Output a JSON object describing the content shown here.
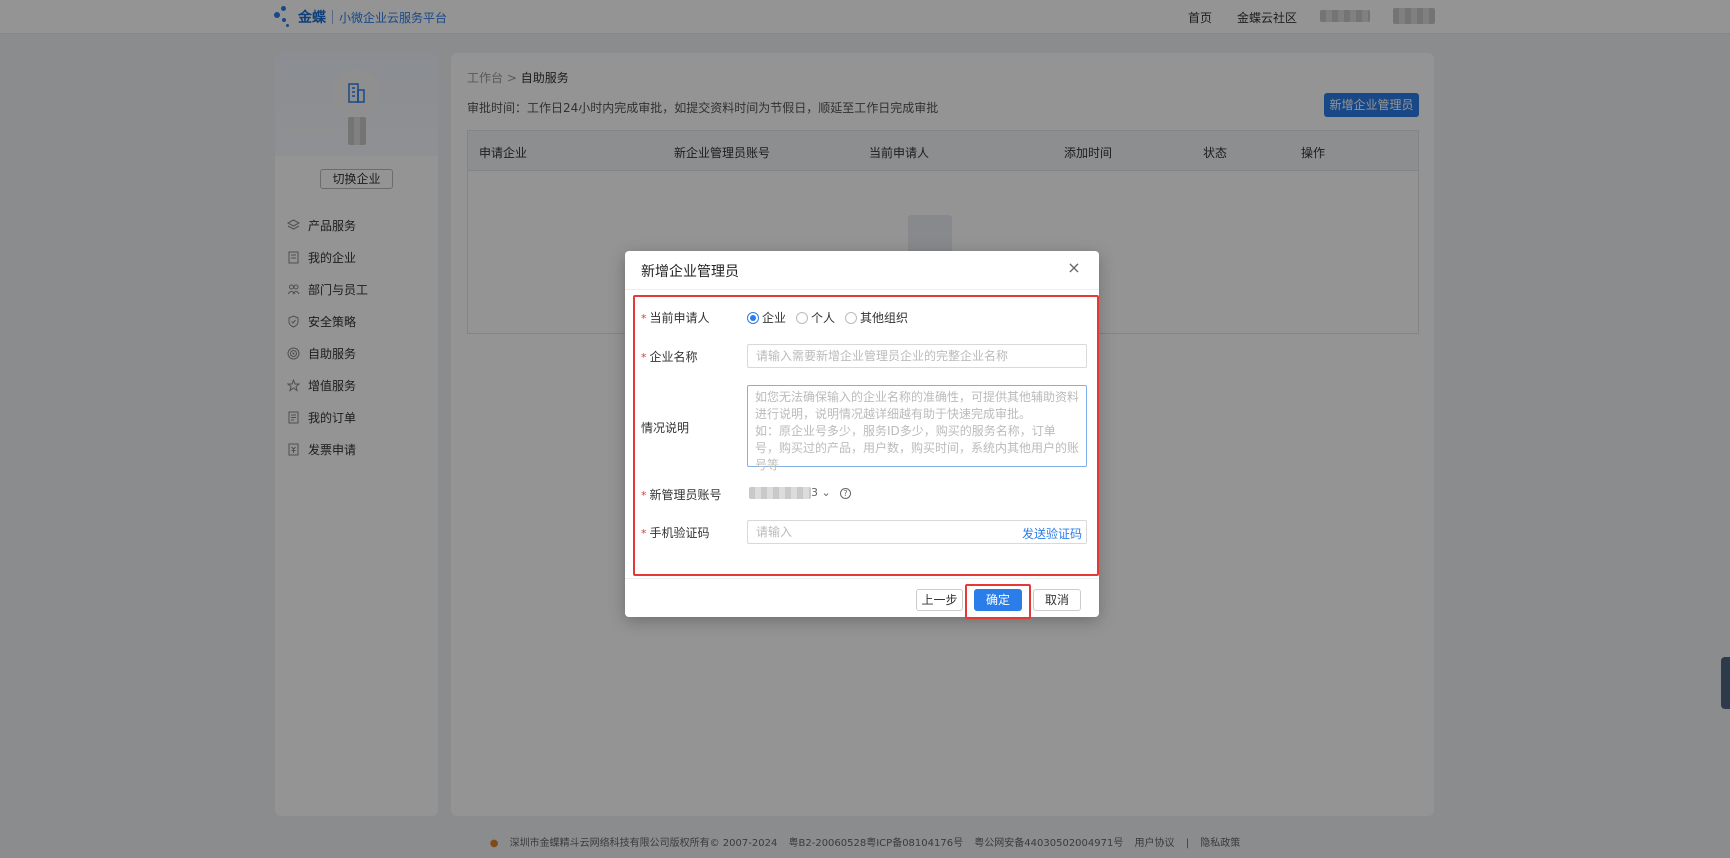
{
  "app": {
    "brand": "金蝶",
    "platform": "小微企业云服务平台"
  },
  "top_nav": {
    "home": "首页",
    "community": "金蝶云社区"
  },
  "sidebar": {
    "switch_label": "切换企业",
    "items": [
      {
        "label": "产品服务",
        "icon": "layers-icon"
      },
      {
        "label": "我的企业",
        "icon": "building-icon"
      },
      {
        "label": "部门与员工",
        "icon": "users-icon"
      },
      {
        "label": "安全策略",
        "icon": "shield-icon"
      },
      {
        "label": "自助服务",
        "icon": "target-icon"
      },
      {
        "label": "增值服务",
        "icon": "star-icon"
      },
      {
        "label": "我的订单",
        "icon": "list-icon"
      },
      {
        "label": "发票申请",
        "icon": "invoice-icon"
      }
    ]
  },
  "main": {
    "breadcrumb_root": "工作台",
    "breadcrumb_sep": ">",
    "breadcrumb_current": "自助服务",
    "approval_note": "审批时间：工作日24小时内完成审批，如提交资料时间为节假日，顺延至工作日完成审批",
    "new_admin_button": "新增企业管理员",
    "table_columns": [
      "申请企业",
      "新企业管理员账号",
      "当前申请人",
      "添加时间",
      "状态",
      "操作"
    ]
  },
  "dialog": {
    "title": "新增企业管理员",
    "close": "×",
    "applicant_label": "当前申请人",
    "applicant_options": [
      "企业",
      "个人",
      "其他组织"
    ],
    "applicant_selected": "企业",
    "company_name_label": "企业名称",
    "company_name_placeholder": "请输入需要新增企业管理员企业的完整企业名称",
    "description_label": "情况说明",
    "description_placeholder": "如您无法确保输入的企业名称的准确性，可提供其他辅助资料进行说明，说明情况越详细越有助于快速完成审批。\n如：原企业号多少，服务ID多少，购买的服务名称，订单号，购买过的产品，用户数，购买时间，系统内其他用户的账号等",
    "account_label": "新管理员账号",
    "account_tail": "3 ⌄",
    "sms_label": "手机验证码",
    "sms_placeholder": "请输入",
    "send_code": "发送验证码",
    "required_mark": "*",
    "btn_prev": "上一步",
    "btn_ok": "确定",
    "btn_cancel": "取消"
  },
  "footer": {
    "copyright": "深圳市金蝶精斗云网络科技有限公司版权所有© 2007-2024",
    "icp": "粤B2-20060528粤ICP备08104176号",
    "police": "粤公网安备44030502004971号",
    "agreement": "用户协议",
    "divider": "|",
    "privacy": "隐私政策"
  },
  "colors": {
    "primary": "#2b7de9",
    "highlight": "#e53935",
    "mask": "rgba(0,0,0,0.42)"
  }
}
